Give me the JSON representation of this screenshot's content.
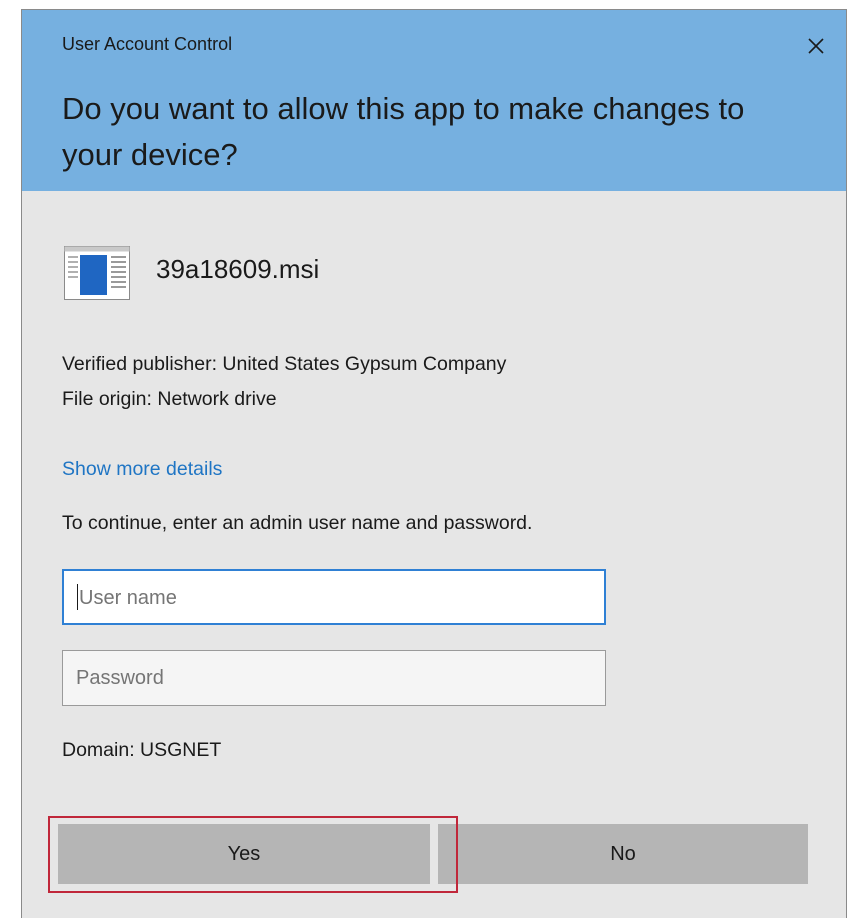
{
  "window": {
    "title": "User Account Control"
  },
  "prompt": {
    "heading": "Do you want to allow this app to make changes to your device?"
  },
  "app": {
    "name": "39a18609.msi",
    "icon": "installer-window-icon"
  },
  "details": {
    "publisher": "Verified publisher: United States Gypsum Company",
    "origin": "File origin: Network drive",
    "show_more_label": "Show more details",
    "instruction": "To continue, enter an admin user name and password."
  },
  "form": {
    "username_placeholder": "User name",
    "username_value": "",
    "password_placeholder": "Password",
    "password_value": "",
    "domain": "Domain: USGNET"
  },
  "buttons": {
    "yes_label": "Yes",
    "no_label": "No"
  },
  "colors": {
    "header": "#76b0e0",
    "body": "#e6e6e6",
    "link": "#1f75c4",
    "focus_border": "#2f80d4",
    "button": "#b5b5b5",
    "highlight": "#c0273a"
  }
}
